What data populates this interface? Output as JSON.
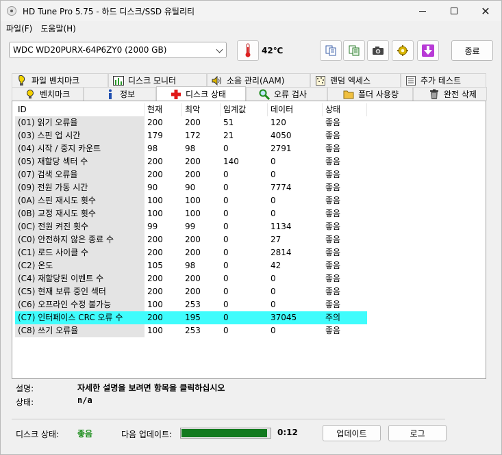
{
  "window": {
    "title": "HD Tune Pro 5.75 - 하드 디스크/SSD 유틸리티"
  },
  "menu": [
    "파일(F)",
    "도움말(H)"
  ],
  "toolbar": {
    "drive": "WDC WD20PURX-64P6ZY0 (2000 GB)",
    "temperature": "42℃",
    "exit_label": "종료"
  },
  "tabs_top": [
    {
      "label": "파일 벤치마크",
      "icon": "file-benchmark-icon"
    },
    {
      "label": "디스크 모니터",
      "icon": "disk-monitor-icon"
    },
    {
      "label": "소음 관리(AAM)",
      "icon": "speaker-icon"
    },
    {
      "label": "랜덤 엑세스",
      "icon": "random-access-icon"
    },
    {
      "label": "추가 테스트",
      "icon": "extra-tests-icon"
    }
  ],
  "tabs_bottom": [
    {
      "label": "벤치마크",
      "icon": "lightbulb-icon"
    },
    {
      "label": "정보",
      "icon": "info-icon"
    },
    {
      "label": "디스크 상태",
      "icon": "health-cross-icon",
      "active": true
    },
    {
      "label": "오류 검사",
      "icon": "magnifier-icon"
    },
    {
      "label": "폴더 사용량",
      "icon": "folder-icon"
    },
    {
      "label": "완전 삭제",
      "icon": "trash-icon"
    }
  ],
  "table": {
    "headers": [
      "ID",
      "현재",
      "최악",
      "임계값",
      "데이터",
      "상태"
    ],
    "rows": [
      [
        "(01) 읽기 오류율",
        "200",
        "200",
        "51",
        "120",
        "좋음"
      ],
      [
        "(03) 스핀 업 시간",
        "179",
        "172",
        "21",
        "4050",
        "좋음"
      ],
      [
        "(04) 시작 / 중지 카운트",
        "98",
        "98",
        "0",
        "2791",
        "좋음"
      ],
      [
        "(05) 재할당 섹터 수",
        "200",
        "200",
        "140",
        "0",
        "좋음"
      ],
      [
        "(07) 검색 오류율",
        "200",
        "200",
        "0",
        "0",
        "좋음"
      ],
      [
        "(09) 전원 가동 시간",
        "90",
        "90",
        "0",
        "7774",
        "좋음"
      ],
      [
        "(0A) 스핀 재시도 횟수",
        "100",
        "100",
        "0",
        "0",
        "좋음"
      ],
      [
        "(0B) 교정 재시도 횟수",
        "100",
        "100",
        "0",
        "0",
        "좋음"
      ],
      [
        "(0C) 전원 켜진 횟수",
        "99",
        "99",
        "0",
        "1134",
        "좋음"
      ],
      [
        "(C0) 안전하지 않은 종료 수",
        "200",
        "200",
        "0",
        "27",
        "좋음"
      ],
      [
        "(C1) 로드 사이클 수",
        "200",
        "200",
        "0",
        "2814",
        "좋음"
      ],
      [
        "(C2) 온도",
        "105",
        "98",
        "0",
        "42",
        "좋음"
      ],
      [
        "(C4) 재할당된 이벤트 수",
        "200",
        "200",
        "0",
        "0",
        "좋음"
      ],
      [
        "(C5) 현재 보류 중인 섹터",
        "200",
        "200",
        "0",
        "0",
        "좋음"
      ],
      [
        "(C6) 오프라인 수정 불가능",
        "100",
        "253",
        "0",
        "0",
        "좋음"
      ],
      [
        "(C7) 인터페이스 CRC 오류 수",
        "200",
        "195",
        "0",
        "37045",
        "주의"
      ],
      [
        "(C8) 쓰기 오류율",
        "100",
        "253",
        "0",
        "0",
        "좋음"
      ]
    ],
    "warn_color": "#3ffcfc"
  },
  "description": {
    "label": "설명:",
    "value": "자세한 설명을 보려면 항목을 클릭하십시오",
    "status_label": "상태:",
    "status_value": "n/a"
  },
  "footer": {
    "disk_status_label": "디스크 상태:",
    "disk_status_value": "좋음",
    "next_update_label": "다음 업데이트:",
    "progress_fraction": 0.97,
    "time": "0:12",
    "update_label": "업데이트",
    "log_label": "로그"
  }
}
